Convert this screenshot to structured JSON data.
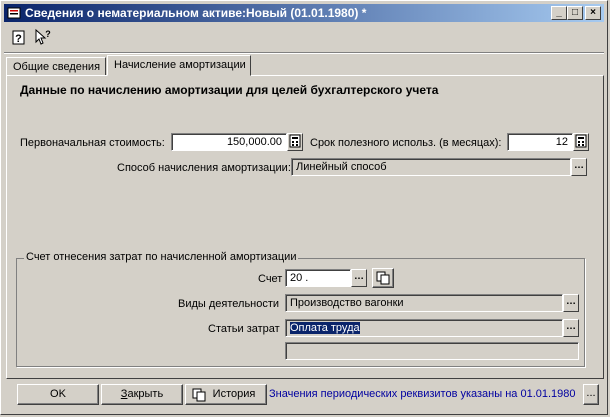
{
  "window": {
    "title": "Сведения о нематериальном активе:Новый (01.01.1980) *",
    "controls": {
      "minimize": "_",
      "maximize": "□",
      "close": "×"
    }
  },
  "toolbar": {
    "help_icon": "help-icon",
    "whatsthis_icon": "whats-this-icon"
  },
  "tabs": [
    {
      "label": "Общие сведения",
      "active": false
    },
    {
      "label": "Начисление амортизации",
      "active": true
    }
  ],
  "panel": {
    "heading": "Данные по начислению амортизации для целей бухгалтерского учета",
    "initial_cost": {
      "label": "Первоначальная стоимость:",
      "value": "150,000.00"
    },
    "useful_life": {
      "label": "Срок полезного использ. (в месяцах):",
      "value": "12"
    },
    "depr_method": {
      "label": "Способ начисления амортизации:",
      "value": "Линейный способ"
    },
    "cost_group": {
      "title": "Счет отнесения затрат по начисленной амортизации",
      "account": {
        "label": "Счет",
        "value": "20 ."
      },
      "activity": {
        "label": "Виды деятельности",
        "value": "Производство вагонки"
      },
      "cost_item": {
        "label": "Статьи затрат",
        "value": "Оплата труда"
      },
      "extra": {
        "value": ""
      }
    }
  },
  "footer": {
    "ok": "OK",
    "close_prefix": "",
    "close_underlined": "З",
    "close_rest": "акрыть",
    "history": "История",
    "periodic_note": "Значения периодических реквизитов указаны на 01.01.1980",
    "ellipsis": "..."
  },
  "colors": {
    "title_start": "#0a246a",
    "title_end": "#a6caf0",
    "selection": "#0a246a",
    "note_text": "#0000a0"
  }
}
